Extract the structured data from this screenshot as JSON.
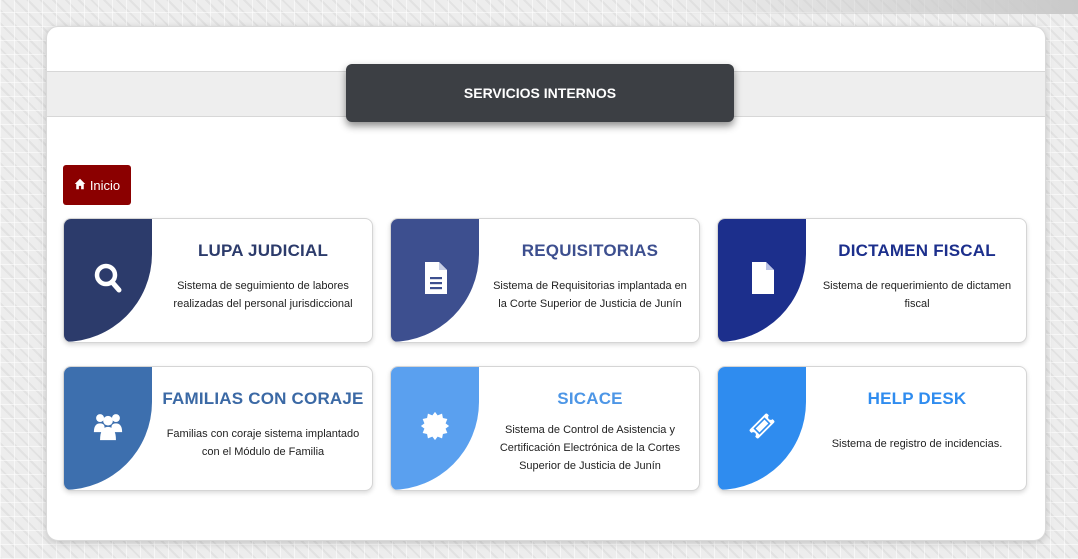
{
  "header": {
    "title": "SERVICIOS INTERNOS"
  },
  "nav": {
    "home_label": "Inicio",
    "home_icon": "home-icon"
  },
  "cards": [
    {
      "title": "LUPA JUDICIAL",
      "desc": "Sistema de seguimiento de labores realizadas del personal jurisdiccional",
      "icon": "search-icon",
      "color": "#2c3b6b",
      "title_color": "#2c3b6b"
    },
    {
      "title": "REQUISITORIAS",
      "desc": "Sistema de Requisitorias implantada en la Corte Superior de Justicia de Junín",
      "icon": "document-icon",
      "color": "#3d4f8f",
      "title_color": "#3d4f8f"
    },
    {
      "title": "DICTAMEN FISCAL",
      "desc": "Sistema de requerimiento de dictamen fiscal",
      "icon": "file-icon",
      "color": "#1c2f8c",
      "title_color": "#1c2f8c"
    },
    {
      "title": "FAMILIAS CON CORAJE",
      "desc": "Familias con coraje sistema implantado con el Módulo de Familia",
      "icon": "users-icon",
      "color": "#3d6fae",
      "title_color": "#3b69a5"
    },
    {
      "title": "SICACE",
      "desc": "Sistema de Control de Asistencia y Certificación Electrónica de la Cortes Superior de Justicia de Junín",
      "icon": "certificate-icon",
      "color": "#5aa0ef",
      "title_color": "#4d96e6"
    },
    {
      "title": "HELP DESK",
      "desc": "Sistema de registro de incidencias.",
      "icon": "ticket-icon",
      "color": "#2f8cef",
      "title_color": "#2f8cef"
    }
  ]
}
